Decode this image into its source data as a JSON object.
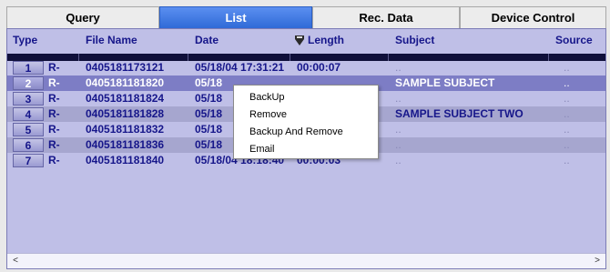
{
  "tabs": [
    {
      "label": "Query"
    },
    {
      "label": "List"
    },
    {
      "label": "Rec. Data"
    },
    {
      "label": "Device Control"
    }
  ],
  "columns": {
    "type": "Type",
    "file_name": "File Name",
    "date": "Date",
    "length": "Length",
    "subject": "Subject",
    "source": "Source"
  },
  "rows": [
    {
      "num": "1",
      "type": "R-",
      "file": "0405181173121",
      "date": "05/18/04 17:31:21",
      "length": "00:00:07",
      "subject": "..",
      "source": ".."
    },
    {
      "num": "2",
      "type": "R-",
      "file": "0405181181820",
      "date": "05/18",
      "length": "",
      "subject": "SAMPLE SUBJECT",
      "source": ".."
    },
    {
      "num": "3",
      "type": "R-",
      "file": "0405181181824",
      "date": "05/18",
      "length": "",
      "subject": "..",
      "source": ".."
    },
    {
      "num": "4",
      "type": "R-",
      "file": "0405181181828",
      "date": "05/18",
      "length": "",
      "subject": "SAMPLE SUBJECT TWO",
      "source": ".."
    },
    {
      "num": "5",
      "type": "R-",
      "file": "0405181181832",
      "date": "05/18",
      "length": "",
      "subject": "..",
      "source": ".."
    },
    {
      "num": "6",
      "type": "R-",
      "file": "0405181181836",
      "date": "05/18",
      "length": "",
      "subject": "..",
      "source": ".."
    },
    {
      "num": "7",
      "type": "R-",
      "file": "0405181181840",
      "date": "05/18/04 18:18:40",
      "length": "00:00:03",
      "subject": "..",
      "source": ".."
    }
  ],
  "context_menu": {
    "items": [
      "BackUp",
      "Remove",
      "Backup And Remove",
      "Email"
    ]
  },
  "scrollbar": {
    "left": "<",
    "right": ">"
  },
  "colors": {
    "tab_active": "#2f6ad7",
    "grid_bg": "#bfbfe7",
    "header_text": "#16168a"
  }
}
